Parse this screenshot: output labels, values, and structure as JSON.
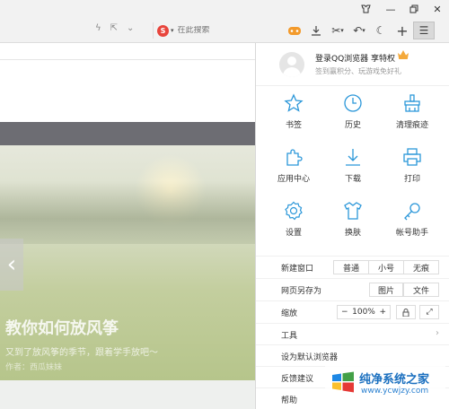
{
  "window": {
    "buttons": [
      "skin-icon",
      "minimize-icon",
      "restore-icon",
      "close-icon"
    ]
  },
  "toolbar": {
    "search_placeholder": "在此搜索",
    "search_engine": "S"
  },
  "page": {
    "hero_title": "教你如何放风筝",
    "hero_subtitle": "又到了放风筝的季节，跟着学手放吧～",
    "hero_author": "作者：西瓜妹妹"
  },
  "menu": {
    "login_title": "登录QQ浏览器 享特权",
    "login_subtitle": "签到赢积分、玩游戏免好礼",
    "grid": [
      {
        "label": "书签",
        "icon": "star-icon"
      },
      {
        "label": "历史",
        "icon": "clock-icon"
      },
      {
        "label": "清理痕迹",
        "icon": "broom-icon"
      },
      {
        "label": "应用中心",
        "icon": "puzzle-icon"
      },
      {
        "label": "下载",
        "icon": "download-icon"
      },
      {
        "label": "打印",
        "icon": "printer-icon"
      },
      {
        "label": "设置",
        "icon": "gear-icon"
      },
      {
        "label": "换肤",
        "icon": "tshirt-icon"
      },
      {
        "label": "帐号助手",
        "icon": "key-icon"
      }
    ],
    "new_window": {
      "label": "新建窗口",
      "options": [
        "普通",
        "小号",
        "无痕"
      ]
    },
    "save_as": {
      "label": "网页另存为",
      "options": [
        "图片",
        "文件"
      ]
    },
    "zoom": {
      "label": "缩放",
      "minus": "−",
      "value": "100%",
      "plus": "+"
    },
    "tools_label": "工具",
    "default_browser_label": "设为默认浏览器",
    "feedback_label": "反馈建议",
    "help_label": "帮助"
  },
  "watermark": {
    "title": "纯净系统之家",
    "url": "www.ycwjzy.com"
  },
  "colors": {
    "icon_blue": "#2b97d9",
    "titlebar": "#f2f2f2"
  }
}
